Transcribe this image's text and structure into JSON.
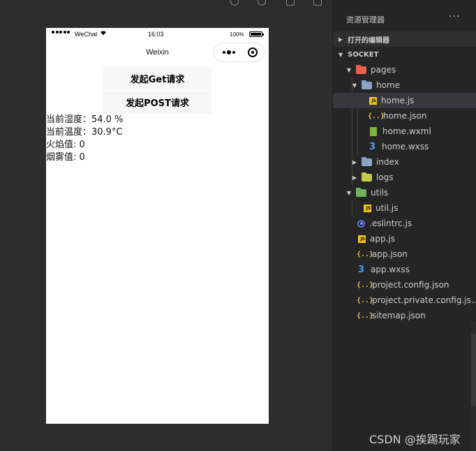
{
  "phone": {
    "status": {
      "carrier": "WeChat",
      "time": "16:03",
      "battery": "100%"
    },
    "nav_title": "Weixin",
    "buttons": {
      "get": "发起Get请求",
      "post": "发起POST请求"
    },
    "readings": [
      "当前湿度：54.0 %",
      "当前温度：30.9°C",
      "火焰值: 0",
      "烟雾值: 0"
    ]
  },
  "explorer": {
    "title": "资源管理器",
    "more": "···",
    "open_editors": "打开的编辑器",
    "project": "SOCKET",
    "tree": {
      "pages": "pages",
      "home": "home",
      "home_js": "home.js",
      "home_json": "home.json",
      "home_wxml": "home.wxml",
      "home_wxss": "home.wxss",
      "index": "index",
      "logs": "logs",
      "utils": "utils",
      "util_js": "util.js",
      "eslintrc": ".eslintrc.js",
      "app_js": "app.js",
      "app_json": "app.json",
      "app_wxss": "app.wxss",
      "project_config": "project.config.json",
      "project_private": "project.private.config.js...",
      "sitemap": "sitemap.json"
    },
    "icons": {
      "js": "JS",
      "json": "{..}",
      "wxss": "3"
    }
  },
  "colors": {
    "folder_pages": "#e8604c",
    "folder_home": "#8aa4c8",
    "folder_index": "#8aa4c8",
    "folder_logs": "#c7c94a",
    "folder_utils": "#6fb35f"
  },
  "watermark": "CSDN @挨踢玩家"
}
